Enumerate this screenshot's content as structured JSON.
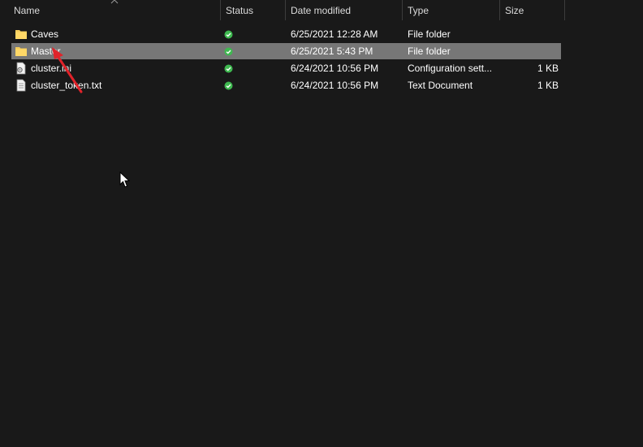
{
  "columns": {
    "name": "Name",
    "status": "Status",
    "date_modified": "Date modified",
    "type": "Type",
    "size": "Size"
  },
  "files": [
    {
      "name": "Caves",
      "date": "6/25/2021 12:28 AM",
      "type": "File folder",
      "size": "",
      "icon": "folder-icon",
      "status_icon": "synced-check-icon",
      "selected": false
    },
    {
      "name": "Master",
      "date": "6/25/2021 5:43 PM",
      "type": "File folder",
      "size": "",
      "icon": "folder-icon",
      "status_icon": "synced-check-icon",
      "selected": true
    },
    {
      "name": "cluster.ini",
      "date": "6/24/2021 10:56 PM",
      "type": "Configuration sett...",
      "size": "1 KB",
      "icon": "config-file-icon",
      "status_icon": "synced-check-icon",
      "selected": false
    },
    {
      "name": "cluster_token.txt",
      "date": "6/24/2021 10:56 PM",
      "type": "Text Document",
      "size": "1 KB",
      "icon": "text-file-icon",
      "status_icon": "synced-check-icon",
      "selected": false
    }
  ],
  "colors": {
    "background": "#191919",
    "selected_row": "#777777",
    "status_green": "#3fb950",
    "folder_yellow": "#f4cc5a",
    "annotation_red": "#e0232a"
  }
}
